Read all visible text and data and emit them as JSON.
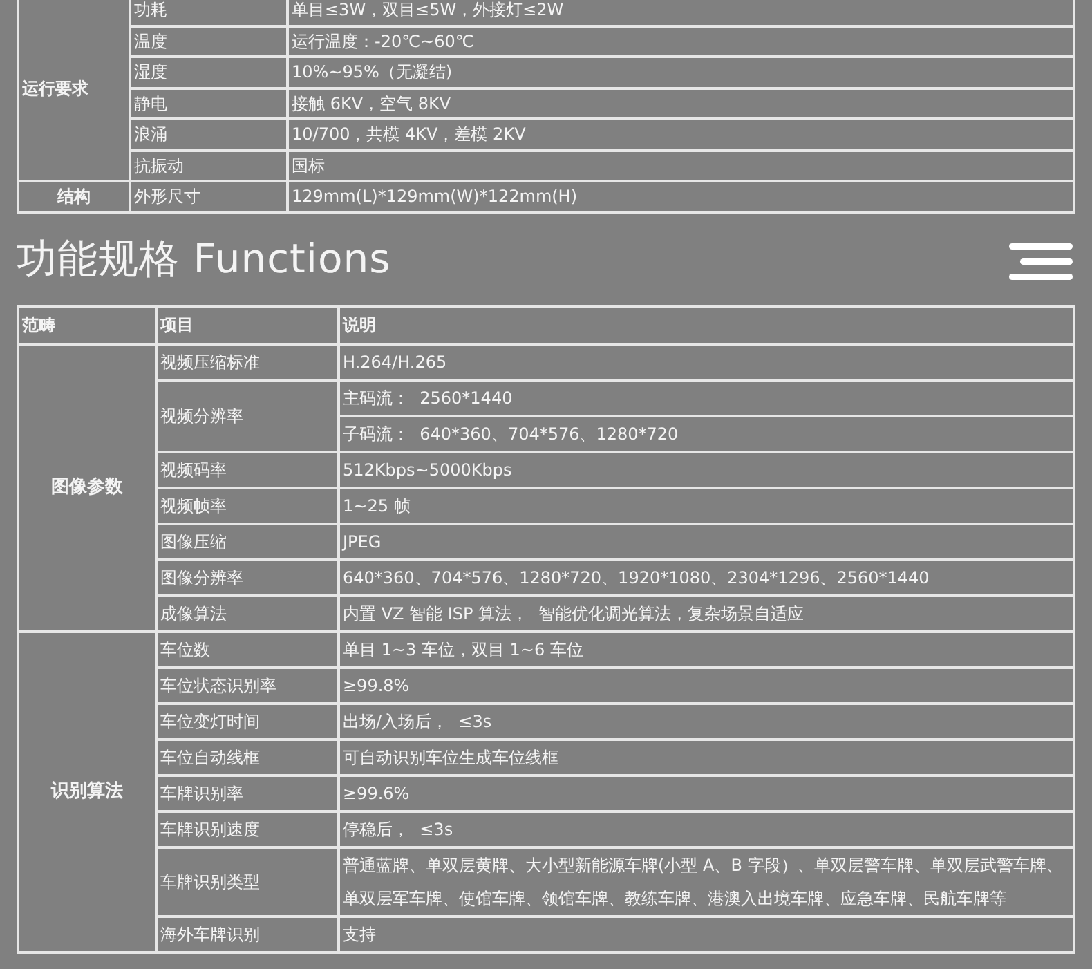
{
  "spec_table": {
    "groups": [
      {
        "category": "运行要求",
        "rows": [
          {
            "item": "功耗",
            "values": [
              "单目≤3W，双目≤5W，外接灯≤2W"
            ]
          },
          {
            "item": "温度",
            "values": [
              "运行温度：-20℃~60℃"
            ]
          },
          {
            "item": "湿度",
            "values": [
              "10%~95%（无凝结)"
            ]
          },
          {
            "item": "静电",
            "values": [
              "接触 6KV，空气 8KV"
            ]
          },
          {
            "item": "浪涌",
            "values": [
              "10/700，共模 4KV，差模 2KV"
            ]
          },
          {
            "item": "抗振动",
            "values": [
              "国标"
            ]
          }
        ]
      },
      {
        "category": "结构",
        "rows": [
          {
            "item": "外形尺寸",
            "values": [
              "129mm(L)*129mm(W)*122mm(H)"
            ]
          }
        ]
      }
    ]
  },
  "functions_section": {
    "title": "功能规格 Functions",
    "table": {
      "columns": [
        "范畴",
        "项目",
        "说明"
      ],
      "groups": [
        {
          "category": "图像参数",
          "rows": [
            {
              "item": "视频压缩标准",
              "values": [
                "H.264/H.265"
              ]
            },
            {
              "item": "视频分辨率",
              "values": [
                "主码流：  2560*1440",
                "子码流：  640*360、704*576、1280*720"
              ]
            },
            {
              "item": "视频码率",
              "values": [
                "512Kbps~5000Kbps"
              ]
            },
            {
              "item": "视频帧率",
              "values": [
                "1~25 帧"
              ]
            },
            {
              "item": "图像压缩",
              "values": [
                "JPEG"
              ]
            },
            {
              "item": "图像分辨率",
              "values": [
                "640*360、704*576、1280*720、1920*1080、2304*1296、2560*1440"
              ]
            },
            {
              "item": "成像算法",
              "values": [
                "内置 VZ 智能 ISP 算法，  智能优化调光算法，复杂场景自适应"
              ]
            }
          ]
        },
        {
          "category": "识别算法",
          "rows": [
            {
              "item": "车位数",
              "values": [
                "单目 1~3 车位，双目 1~6 车位"
              ]
            },
            {
              "item": "车位状态识别率",
              "values": [
                "≥99.8%"
              ]
            },
            {
              "item": "车位变灯时间",
              "values": [
                "出场/入场后，  ≤3s"
              ]
            },
            {
              "item": "车位自动线框",
              "values": [
                "可自动识别车位生成车位线框"
              ]
            },
            {
              "item": "车牌识别率",
              "values": [
                "≥99.6%"
              ]
            },
            {
              "item": "车牌识别速度",
              "values": [
                "停稳后，  ≤3s"
              ]
            },
            {
              "item": "车牌识别类型",
              "values": [
                "普通蓝牌、单双层黄牌、大小型新能源车牌(小型 A、B 字段）、单双层警车牌、单双层武警车牌、单双层军车牌、使馆车牌、领馆车牌、教练车牌、港澳入出境车牌、应急车牌、民航车牌等"
              ]
            },
            {
              "item": "海外车牌识别",
              "values": [
                "支持"
              ]
            }
          ]
        }
      ]
    }
  }
}
